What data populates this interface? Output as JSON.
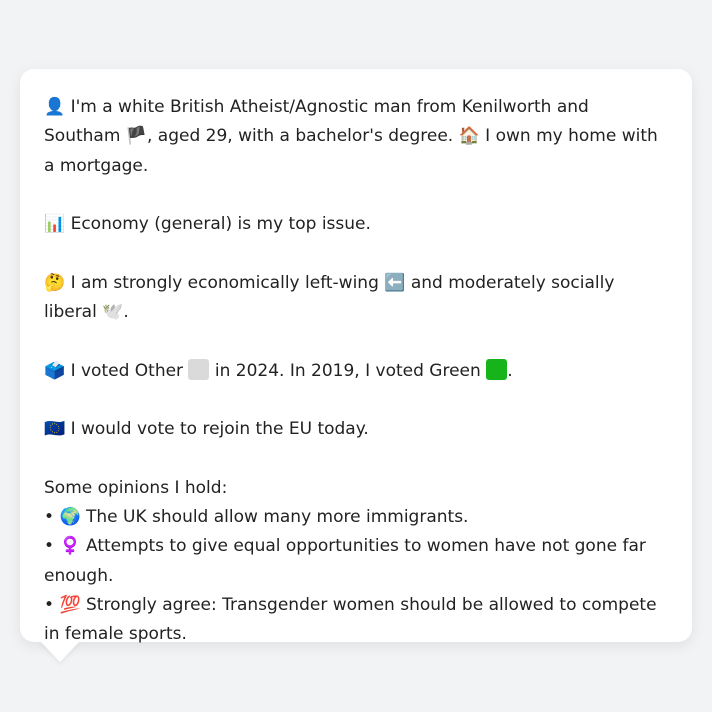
{
  "profile": {
    "intro_icon": "👤",
    "intro_text_1": "I'm a white British Atheist/Agnostic man from Kenilworth and Southam",
    "intro_flag": "🏴",
    "intro_text_2": ", aged 29, with a bachelor's degree.",
    "home_icon": "🏠",
    "home_text": "I own my home with a mortgage.",
    "issue_icon": "📊",
    "issue_text": "Economy (general) is my top issue.",
    "ideology_icon": "🤔",
    "ideology_text_1": "I am strongly economically left-wing",
    "left_icon": "⬅️",
    "ideology_text_2": "and moderately socially liberal",
    "dove_icon": "🕊️",
    "ideology_end": ".",
    "vote_icon": "🗳️",
    "vote_text_1": "I voted Other",
    "other_color": "#dadada",
    "vote_text_2": "in 2024. In 2019, I voted Green",
    "green_color": "#17b31a",
    "vote_end": ".",
    "eu_icon": "🇪🇺",
    "eu_text": "I would vote to rejoin the EU today.",
    "opinions_header": "Some opinions I hold:",
    "opinions": [
      {
        "bullet": "•",
        "icon": "🌍",
        "text": "The UK should allow many more immigrants."
      },
      {
        "bullet": "•",
        "icon": "♀️",
        "text": "Attempts to give equal opportunities to women have not gone far enough."
      },
      {
        "bullet": "•",
        "icon": "💯",
        "text": "Strongly agree: Transgender women should be allowed to compete in female sports."
      }
    ]
  }
}
